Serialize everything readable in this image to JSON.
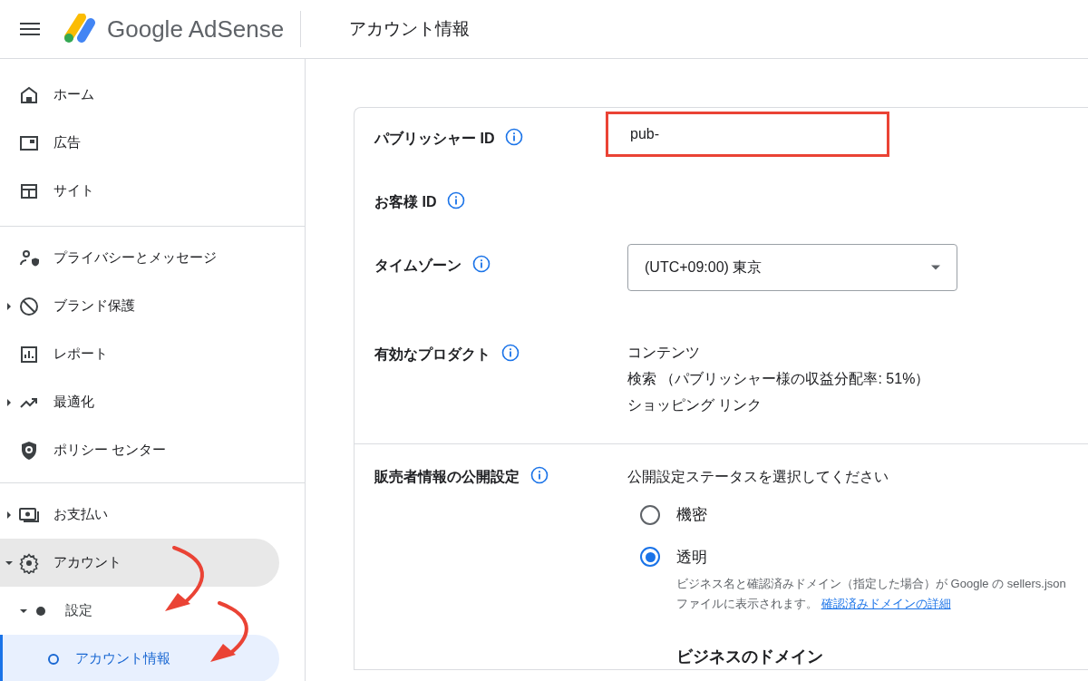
{
  "header": {
    "product_name": "Google AdSense",
    "page_title": "アカウント情報"
  },
  "sidebar": {
    "groups": [
      [
        {
          "label": "ホーム",
          "selected": false
        },
        {
          "label": "広告",
          "selected": false
        },
        {
          "label": "サイト",
          "selected": false
        }
      ],
      [
        {
          "label": "プライバシーとメッセージ",
          "selected": false
        },
        {
          "label": "ブランド保護",
          "selected": false,
          "expanded": false
        },
        {
          "label": "レポート",
          "selected": false
        },
        {
          "label": "最適化",
          "selected": false,
          "expanded": false
        },
        {
          "label": "ポリシー センター",
          "selected": false
        }
      ],
      [
        {
          "label": "お支払い",
          "selected": false,
          "expanded": false
        },
        {
          "label": "アカウント",
          "selected": false,
          "expanded": true,
          "children": [
            {
              "label": "設定",
              "selected": false,
              "expanded": true,
              "children": [
                {
                  "label": "アカウント情報",
                  "selected": true
                }
              ]
            }
          ]
        }
      ]
    ]
  },
  "account_card": {
    "rows": [
      {
        "kind": "text",
        "label": "パブリッシャー ID",
        "value": "pub-",
        "highlighted": true
      },
      {
        "kind": "text",
        "label": "お客様 ID"
      },
      {
        "kind": "select",
        "label": "タイムゾーン",
        "value": "(UTC+09:00) 東京"
      },
      {
        "kind": "lines",
        "label": "有効なプロダクト",
        "lines": [
          "コンテンツ",
          "検索 （パブリッシャー様の収益分配率: 51%）",
          "ショッピング リンク"
        ]
      }
    ],
    "seller_section": {
      "label": "販売者情報の公開設定",
      "prompt": "公開設定ステータスを選択してください",
      "options": [
        {
          "label": "機密",
          "selected": false
        },
        {
          "label": "透明",
          "selected": true,
          "description": "ビジネス名と確認済みドメイン（指定した場合）が Google の sellers.json ファイルに表示されます。",
          "link": "確認済みドメインの詳細"
        }
      ],
      "subheading": "ビジネスのドメイン"
    }
  }
}
